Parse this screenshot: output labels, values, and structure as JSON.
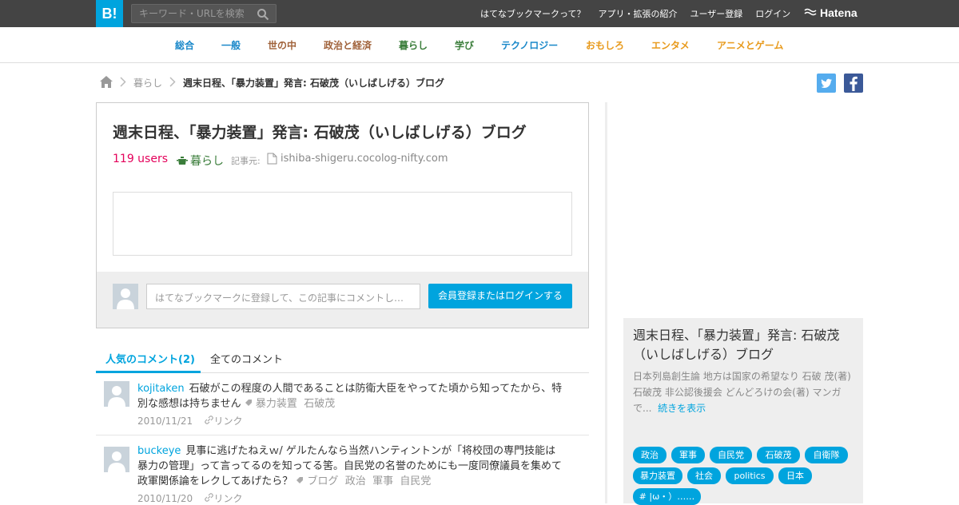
{
  "header": {
    "logo": "B!",
    "search_placeholder": "キーワード・URLを検索",
    "links": [
      "はてなブックマークって？",
      "アプリ・拡張の紹介",
      "ユーザー登録",
      "ログイン"
    ],
    "brand": "Hatena"
  },
  "categories": [
    {
      "label": "総合",
      "color": "#1a88c9"
    },
    {
      "label": "一般",
      "color": "#1a88c9"
    },
    {
      "label": "世の中",
      "color": "#a0623a"
    },
    {
      "label": "政治と経済",
      "color": "#a0623a"
    },
    {
      "label": "暮らし",
      "color": "#3a7d3a"
    },
    {
      "label": "学び",
      "color": "#3a7d3a"
    },
    {
      "label": "テクノロジー",
      "color": "#1a88c9"
    },
    {
      "label": "おもしろ",
      "color": "#e89a1c"
    },
    {
      "label": "エンタメ",
      "color": "#e89a1c"
    },
    {
      "label": "アニメとゲーム",
      "color": "#e89a1c"
    }
  ],
  "breadcrumb": {
    "category": "暮らし",
    "current": "週末日程、「暴力装置」発言: 石破茂（いしばしげる）ブログ"
  },
  "entry": {
    "title": "週末日程、「暴力装置」発言: 石破茂（いしばしげる）ブログ",
    "users": "119 users",
    "category": "暮らし",
    "source_label": "記事元:",
    "source": "ishiba-shigeru.cocolog-nifty.com",
    "comment_placeholder": "はてなブックマークに登録して、この記事にコメントしよう",
    "login_button": "会員登録またはログインする"
  },
  "tabs": {
    "popular": "人気のコメント(2)",
    "all": "全てのコメント"
  },
  "comments": [
    {
      "user": "kojitaken",
      "text": "石破がこの程度の人間であることは防衛大臣をやってた頃から知ってたから、特別な感想は持ちません",
      "tags": [
        "暴力装置",
        "石破茂"
      ],
      "date": "2010/11/21",
      "link": "リンク"
    },
    {
      "user": "buckeye",
      "text": "見事に逃げたねえｗ/ ゲルたんなら当然ハンティントンが「将校団の専門技能は暴力の管理」って言ってるのを知ってる筈。自民党の名誉のためにも一度同僚議員を集めて政軍関係論をレクしてあげたら？",
      "tags": [
        "ブログ",
        "政治",
        "軍事",
        "自民党"
      ],
      "date": "2010/11/20",
      "link": "リンク"
    }
  ],
  "sidebar": {
    "title": "週末日程、「暴力装置」発言: 石破茂（いしばしげる）ブログ",
    "desc": "日本列島創生論 地方は国家の希望なり 石破 茂(著) 石破茂 非公認後援会 どんどろけの会(著) マンガで...",
    "more": "続きを表示",
    "tags": [
      "政治",
      "軍事",
      "自民党",
      "石破茂",
      "自衛隊",
      "暴力装置",
      "社会",
      "politics",
      "日本",
      "# |ω・）……"
    ]
  },
  "colors": {
    "accent": "#00a4de",
    "users": "#e4005a",
    "topbar": "#444444"
  }
}
